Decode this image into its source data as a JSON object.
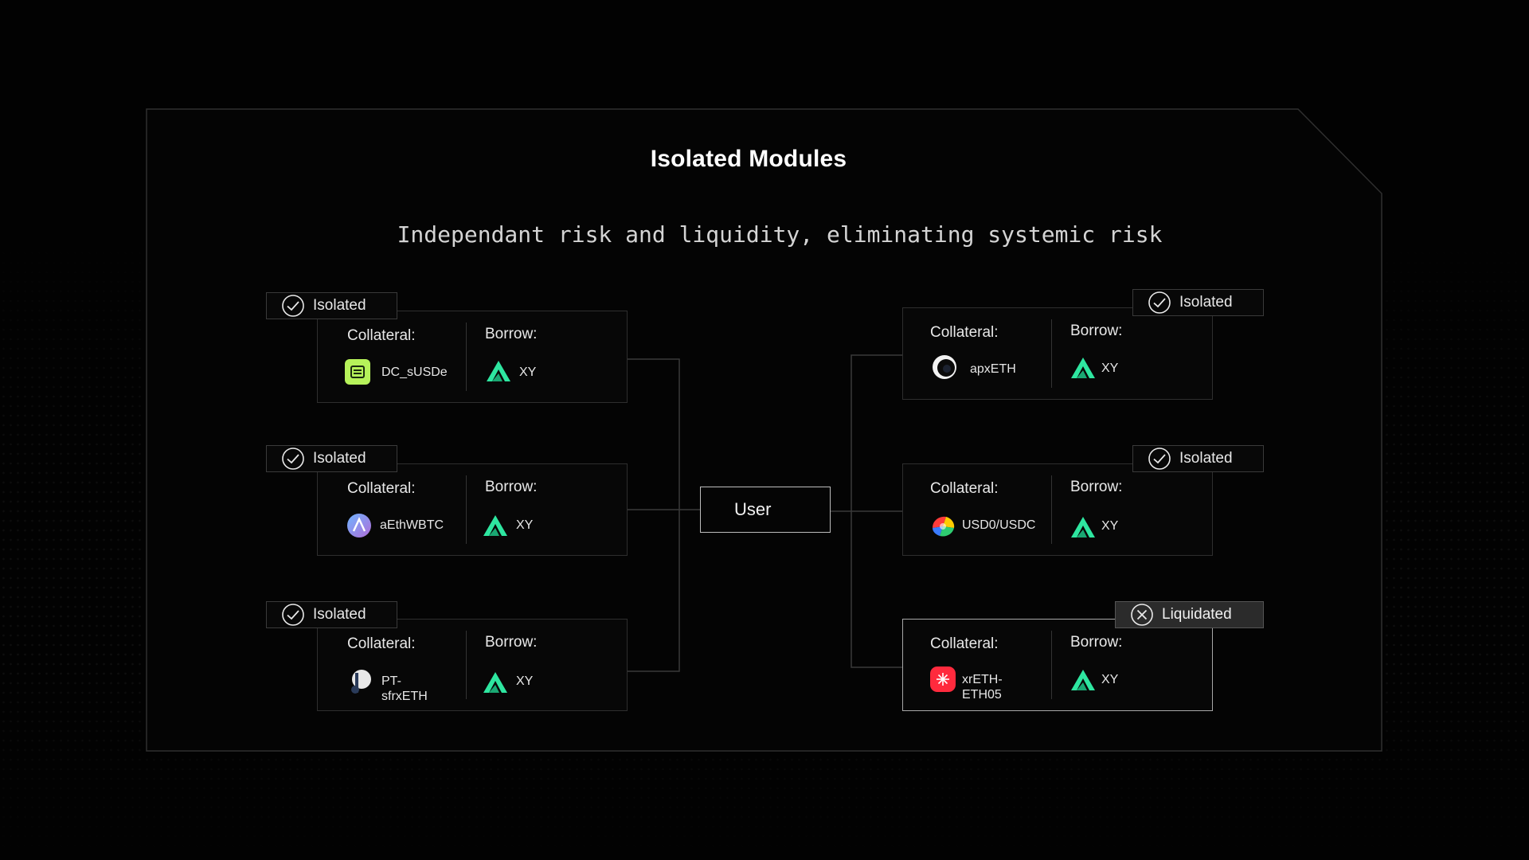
{
  "title": "Isolated Modules",
  "subtitle": "Independant risk and liquidity, eliminating systemic risk",
  "user_label": "User",
  "labels": {
    "collateral": "Collateral:",
    "borrow": "Borrow:"
  },
  "colors": {
    "accent_green": "#2ee6a0",
    "sky": "#6fb4ff",
    "red": "#ff2a3d",
    "lime": "#b6f25a"
  },
  "left_modules": [
    {
      "status": "Isolated",
      "status_icon": "check-circle-icon",
      "collateral_asset": "DC_sUSDe",
      "collateral_icon": "susde-icon",
      "borrow_asset": "XY",
      "borrow_icon": "xy-logo-icon"
    },
    {
      "status": "Isolated",
      "status_icon": "check-circle-icon",
      "collateral_asset": "aEthWBTC",
      "collateral_icon": "aave-icon",
      "borrow_asset": "XY",
      "borrow_icon": "xy-logo-icon"
    },
    {
      "status": "Isolated",
      "status_icon": "check-circle-icon",
      "collateral_asset": "PT-sfrxETH",
      "collateral_icon": "pendle-icon",
      "borrow_asset": "XY",
      "borrow_icon": "xy-logo-icon"
    }
  ],
  "right_modules": [
    {
      "status": "Isolated",
      "status_icon": "check-circle-icon",
      "collateral_asset": "apxETH",
      "collateral_icon": "apxeth-icon",
      "borrow_asset": "XY",
      "borrow_icon": "xy-logo-icon"
    },
    {
      "status": "Isolated",
      "status_icon": "check-circle-icon",
      "collateral_asset": "USD0/USDC",
      "collateral_icon": "curve-icon",
      "borrow_asset": "XY",
      "borrow_icon": "xy-logo-icon"
    },
    {
      "status": "Liquidated",
      "status_icon": "x-circle-icon",
      "collateral_asset": "xrETH-ETH05",
      "collateral_icon": "xreth-icon",
      "borrow_asset": "XY",
      "borrow_icon": "xy-logo-icon"
    }
  ]
}
